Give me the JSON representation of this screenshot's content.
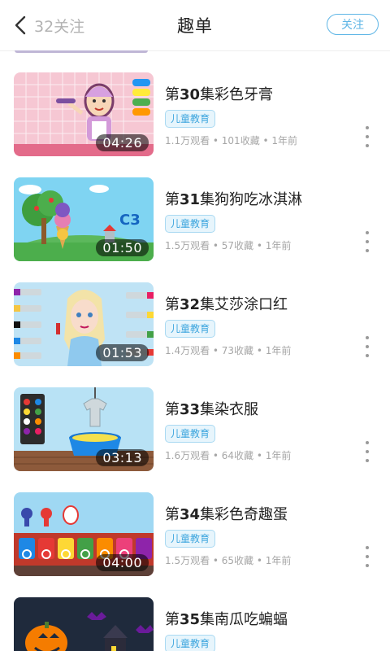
{
  "header": {
    "back_label": "32关注",
    "title": "趣单",
    "follow_label": "关注"
  },
  "items": [
    {
      "ep": "第",
      "num": "30",
      "name": "集彩色牙膏",
      "tag": "儿童教育",
      "duration": "04:26",
      "stats": "1.1万观看 • 101收藏 • 1年前"
    },
    {
      "ep": "第",
      "num": "31",
      "name": "集狗狗吃冰淇淋",
      "tag": "儿童教育",
      "duration": "01:50",
      "stats": "1.5万观看 • 57收藏 • 1年前"
    },
    {
      "ep": "第",
      "num": "32",
      "name": "集艾莎涂口红",
      "tag": "儿童教育",
      "duration": "01:53",
      "stats": "1.4万观看 • 73收藏 • 1年前"
    },
    {
      "ep": "第",
      "num": "33",
      "name": "集染衣服",
      "tag": "儿童教育",
      "duration": "03:13",
      "stats": "1.6万观看 • 64收藏 • 1年前"
    },
    {
      "ep": "第",
      "num": "34",
      "name": "集彩色奇趣蛋",
      "tag": "儿童教育",
      "duration": "04:00",
      "stats": "1.5万观看 • 65收藏 • 1年前"
    },
    {
      "ep": "第",
      "num": "35",
      "name": "集南瓜吃蝙蝠",
      "tag": "儿童教育",
      "duration": "",
      "stats": ""
    }
  ],
  "colors": {
    "accent": "#5fb6e6",
    "tag_text": "#3ea6de",
    "tag_bg": "#e7f5fc",
    "meta_text": "#a6a6a6"
  }
}
